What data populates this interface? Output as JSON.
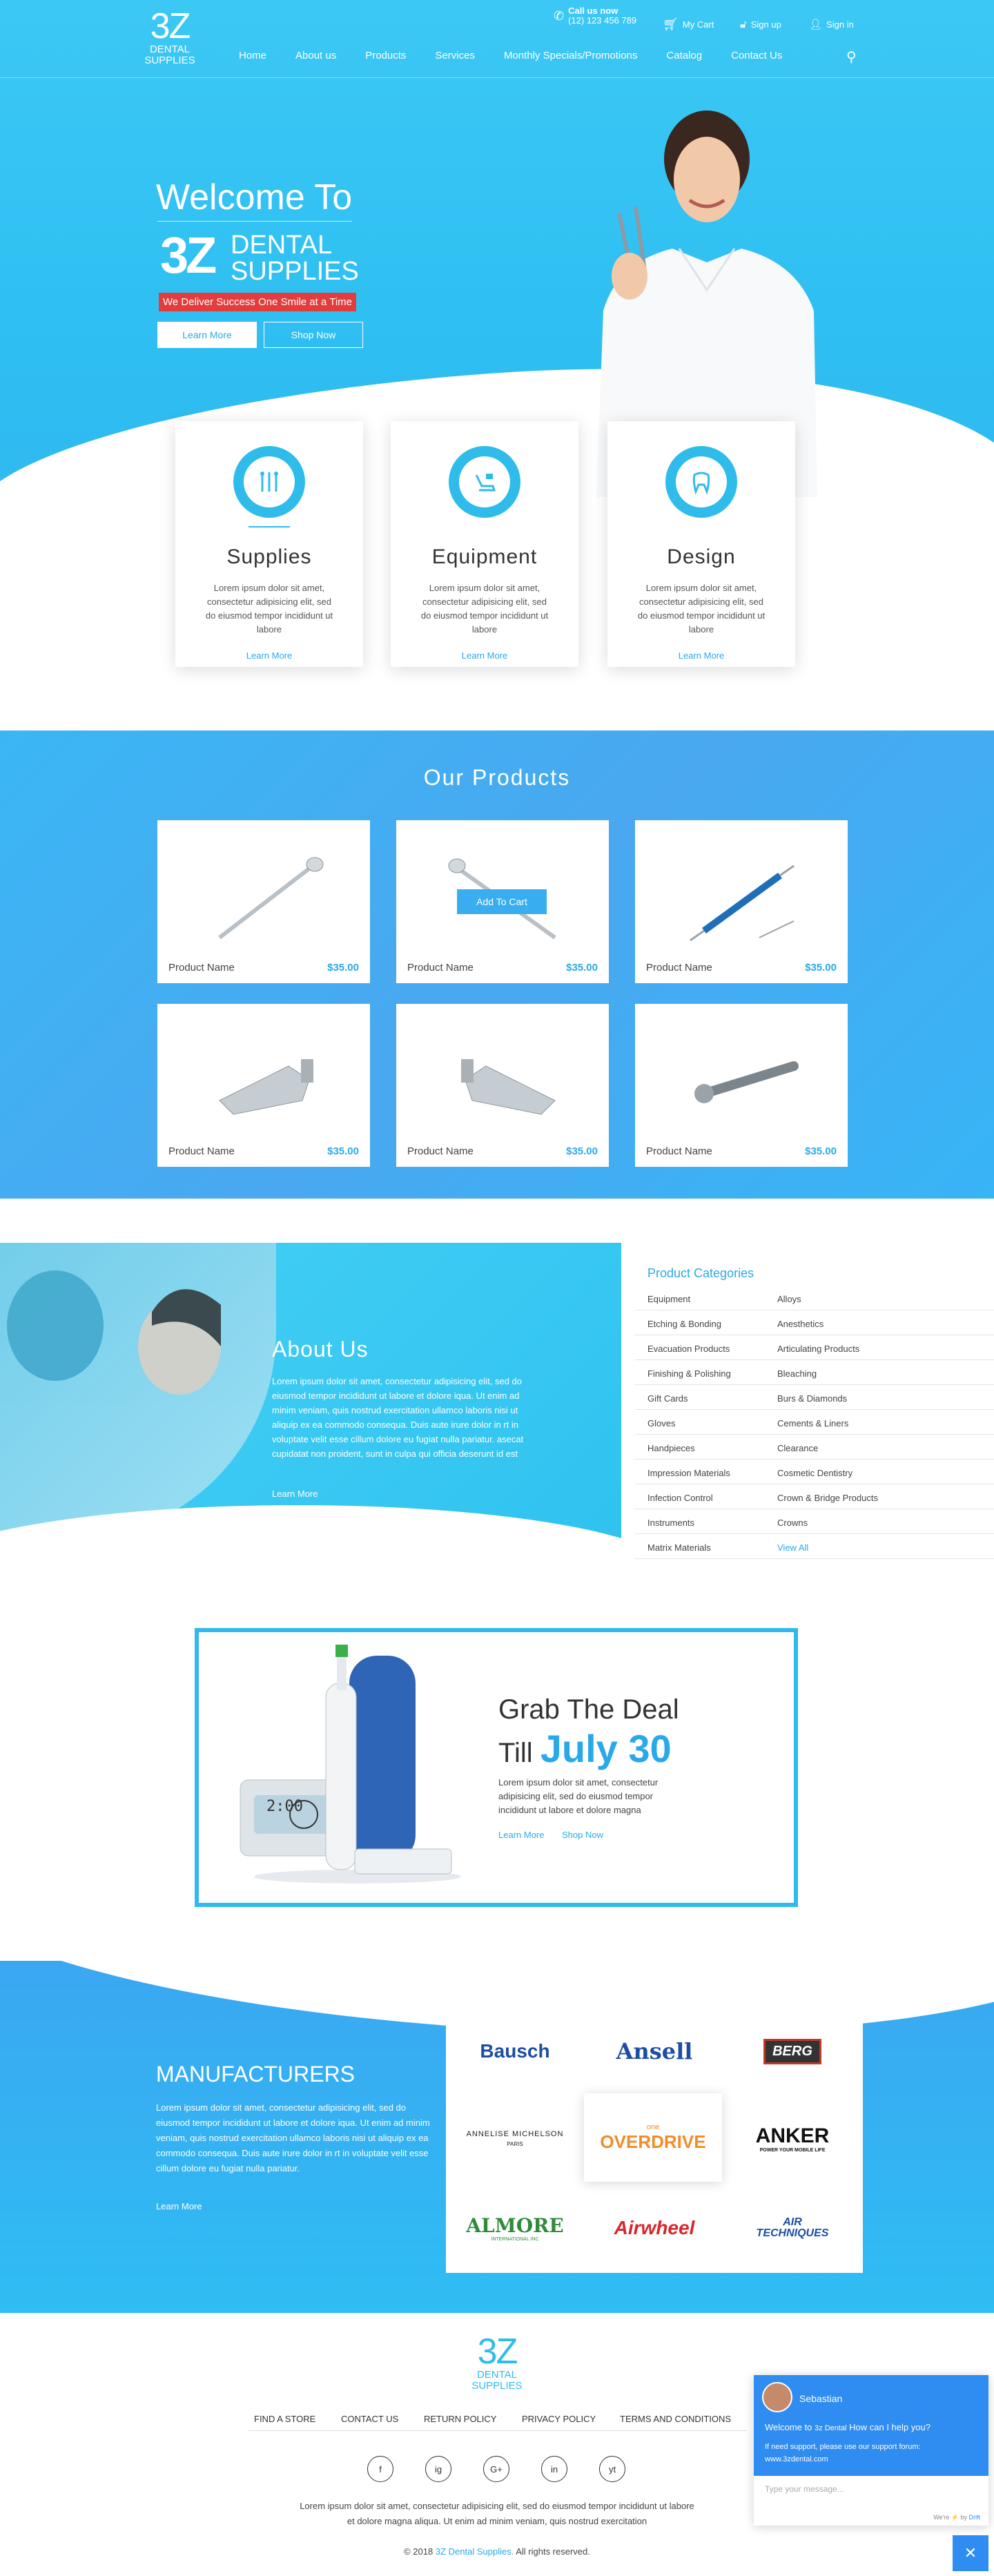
{
  "brand": {
    "logo_big": "3Z",
    "logo_small": "DENTAL SUPPLIES"
  },
  "topbar": {
    "call_label": "Call us now",
    "phone": "(12) 123 456 789",
    "cart": "My Cart",
    "signup": "Sign up",
    "signin": "Sign in"
  },
  "nav": [
    "Home",
    "About us",
    "Products",
    "Services",
    "Monthly Specials/Promotions",
    "Catalog",
    "Contact Us"
  ],
  "hero": {
    "welcome": "Welcome To",
    "brand_line1": "DENTAL",
    "brand_line2": "SUPPLIES",
    "tagline": "We Deliver Success One Smile at a Time",
    "learn_more": "Learn More",
    "shop_now": "Shop Now"
  },
  "features": [
    {
      "title": "Supplies",
      "text": "Lorem ipsum dolor sit amet, consectetur adipisicing elit, sed do eiusmod tempor incididunt ut labore",
      "link": "Learn More",
      "icon": "dental-tools-icon"
    },
    {
      "title": "Equipment",
      "text": "Lorem ipsum dolor sit amet, consectetur adipisicing elit, sed do eiusmod tempor incididunt ut labore",
      "link": "Learn More",
      "icon": "dental-chair-icon"
    },
    {
      "title": "Design",
      "text": "Lorem ipsum dolor sit amet, consectetur adipisicing elit, sed do eiusmod tempor incididunt ut labore",
      "link": "Learn More",
      "icon": "tooth-icon"
    }
  ],
  "products": {
    "title": "Our Products",
    "add_to_cart": "Add To Cart",
    "items": [
      {
        "name": "Product Name",
        "price": "$35.00"
      },
      {
        "name": "Product Name",
        "price": "$35.00"
      },
      {
        "name": "Product Name",
        "price": "$35.00"
      },
      {
        "name": "Product Name",
        "price": "$35.00"
      },
      {
        "name": "Product Name",
        "price": "$35.00"
      },
      {
        "name": "Product Name",
        "price": "$35.00"
      }
    ]
  },
  "about": {
    "title": "About Us",
    "text": "Lorem ipsum dolor sit amet, consectetur adipisicing elit, sed do eiusmod tempor incididunt ut labore et dolore iqua. Ut enim ad minim veniam, quis nostrud exercitation ullamco laboris nisi ut aliquip ex ea commodo consequa. Duis aute irure dolor in rt in voluptate velit esse cillum dolore eu fugiat nulla pariatur. asecat cupidatat non proident, sunt in culpa qui officia deserunt id est",
    "link": "Learn More"
  },
  "categories": {
    "title": "Product Categories",
    "left": [
      "Equipment",
      "Etching & Bonding",
      "Evacuation Products",
      "Finishing & Polishing",
      "Gift Cards",
      "Gloves",
      "Handpieces",
      "Impression Materials",
      "Infection Control",
      "Instruments",
      "Matrix Materials"
    ],
    "right": [
      "Alloys",
      "Anesthetics",
      "Articulating Products",
      "Bleaching",
      "Burs & Diamonds",
      "Cements & Liners",
      "Clearance",
      "Cosmetic Dentistry",
      "Crown & Bridge Products",
      "Crowns",
      "View All"
    ]
  },
  "deal": {
    "line1": "Grab The Deal",
    "till": "Till",
    "date": "July 30",
    "text": "Lorem ipsum dolor sit amet, consectetur adipisicing elit, sed do eiusmod tempor incididunt ut labore et dolore magna",
    "learn_more": "Learn More",
    "shop_now": "Shop Now",
    "display": "2:00"
  },
  "manufacturers": {
    "title": "MANUFACTURERS",
    "text": "Lorem ipsum dolor sit amet, consectetur adipisicing elit, sed do eiusmod tempor incididunt ut labore et dolore iqua. Ut enim ad minim veniam, quis nostrud exercitation ullamco laboris nisi ut aliquip ex ea commodo consequa. Duis aute irure dolor in rt in voluptate velit esse cillum dolore eu fugiat nulla pariatur.",
    "link": "Learn More",
    "logos": [
      "Bausch",
      "Ansell",
      "BERG",
      "ANNELISE MICHELSON",
      "OVERDRIVE",
      "ANKER",
      "ALMORE",
      "Airwheel",
      "AIR TECHNIQUES"
    ],
    "logo_sub": {
      "annelise": "PARIS",
      "overdrive_top": "one",
      "anker": "POWER YOUR MOBILE LIFE",
      "almore": "INTERNATIONAL INC"
    }
  },
  "footer": {
    "links": [
      "FIND A STORE",
      "CONTACT US",
      "RETURN POLICY",
      "PRIVACY POLICY",
      "TERMS AND CONDITIONS"
    ],
    "social": [
      "f",
      "ig",
      "G+",
      "in",
      "yt"
    ],
    "text1": "Lorem ipsum dolor sit amet, consectetur adipisicing elit, sed do eiusmod tempor incididunt ut labore",
    "text2": "et dolore magna aliqua. Ut enim ad minim veniam, quis nostrud exercitation",
    "copy_prefix": "© 2018",
    "copy_brand": "3Z Dental Supplies.",
    "copy_suffix": "All rights reserved."
  },
  "chat": {
    "agent": "Sebastian",
    "welcome": "Welcome to",
    "brand": "3z Dental",
    "question": "How can I help you?",
    "support": "If need support, please use our support forum:",
    "url": "www.3zdental.com",
    "placeholder": "Type your message...",
    "powered": "We're ⚡ by",
    "powered_brand": "Drift"
  },
  "colors": {
    "primary": "#2fbcea",
    "accent": "#2aa9e8",
    "red": "#e23c3c"
  }
}
